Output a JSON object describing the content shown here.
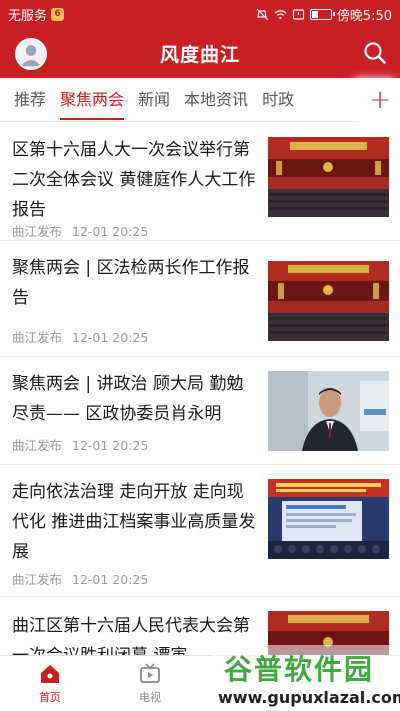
{
  "status_bar": {
    "carrier": "无服务",
    "carrier_badge": "6",
    "time_label": "傍晚5:50",
    "battery_level": 0.3
  },
  "app_bar": {
    "title": "风度曲江",
    "avatar_icon": "user-avatar-icon",
    "search_icon": "search-icon"
  },
  "tabs": {
    "items": [
      {
        "label": "推荐",
        "active": false
      },
      {
        "label": "聚焦两会",
        "active": true
      },
      {
        "label": "新闻",
        "active": false
      },
      {
        "label": "本地资讯",
        "active": false
      },
      {
        "label": "时政",
        "active": false
      }
    ],
    "add_label": "+"
  },
  "news": [
    {
      "title": "区第十六届人大一次会议举行第二次全体会议 黄健庭作人大工作报告",
      "source": "曲江发布",
      "time": "12-01 20:25",
      "image": "conference-hall-photo"
    },
    {
      "title": "聚焦两会 | 区法检两长作工作报告",
      "source": "曲江发布",
      "time": "12-01 20:25",
      "image": "conference-hall-photo"
    },
    {
      "title": "聚焦两会 | 讲政治 顾大局 勤勉尽责—— 区政协委员肖永明",
      "source": "曲江发布",
      "time": "12-01 20:25",
      "image": "interview-portrait-photo"
    },
    {
      "title": "走向依法治理 走向开放 走向现代化 推进曲江档案事业高质量发展",
      "source": "曲江发布",
      "time": "12-01 20:25",
      "image": "presentation-screen-photo"
    },
    {
      "title": "曲江区第十六届人民代表大会第一次会议胜利闭幕 谭寅",
      "source": "",
      "time": "",
      "image": "conference-hall-photo"
    }
  ],
  "bottom_nav": {
    "items": [
      {
        "label": "首页",
        "icon": "home-icon",
        "active": true
      },
      {
        "label": "电视",
        "icon": "tv-icon",
        "active": false
      }
    ]
  },
  "watermark": {
    "brand": "谷普软件园",
    "url": "www.gupuxlazal.com"
  },
  "colors": {
    "brand_red": "#c81e24",
    "meta_gray": "#999999"
  }
}
